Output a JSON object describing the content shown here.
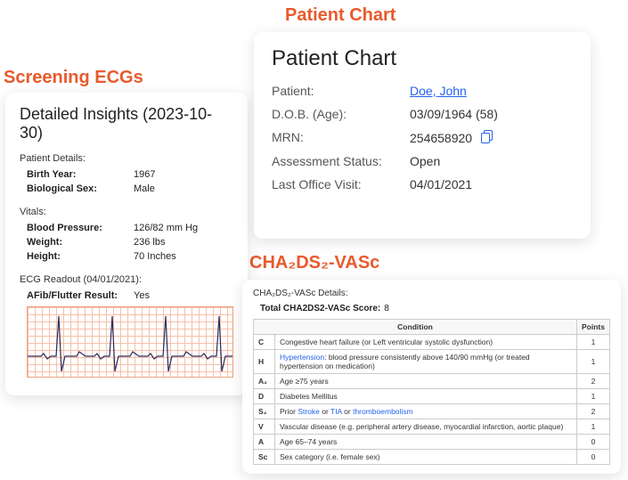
{
  "labels": {
    "patient_chart": "Patient Chart",
    "screening_ecgs": "Screening ECGs",
    "chadsvasc": "CHA₂DS₂-VASc"
  },
  "patient_chart": {
    "title": "Patient Chart",
    "rows": {
      "patient_k": "Patient:",
      "patient_v": "Doe, John",
      "dob_k": "D.O.B. (Age):",
      "dob_v": "03/09/1964 (58)",
      "mrn_k": "MRN:",
      "mrn_v": "254658920",
      "status_k": "Assessment Status:",
      "status_v": "Open",
      "visit_k": "Last Office Visit:",
      "visit_v": "04/01/2021"
    }
  },
  "ecg": {
    "title": "Detailed Insights (2023-10-30)",
    "patient_details": "Patient Details:",
    "birth_year_k": "Birth Year:",
    "birth_year_v": "1967",
    "sex_k": "Biological Sex:",
    "sex_v": "Male",
    "vitals": "Vitals:",
    "bp_k": "Blood Pressure:",
    "bp_v": "126/82 mm Hg",
    "wt_k": "Weight:",
    "wt_v": "236 lbs",
    "ht_k": "Height:",
    "ht_v": "70 Inches",
    "readout": "ECG Readout (04/01/2021):",
    "afib_k": "AFib/Flutter Result:",
    "afib_v": "Yes"
  },
  "cha": {
    "title": "CHA₂DS₂-VASc Details:",
    "score_label": "Total CHA2DS2-VASc Score:",
    "score_value": "8",
    "headers": {
      "cond": "Condition",
      "pts": "Points"
    },
    "rows": [
      {
        "code": "C",
        "cond_pre": "Congestive heart failure (or Left ventricular systolic dysfunction)",
        "link": "",
        "cond_post": "",
        "pts": "1"
      },
      {
        "code": "H",
        "cond_pre": "",
        "link": "Hypertension",
        "cond_post": ": blood pressure consistently above 140/90 mmHg (or treated hypertension on medication)",
        "pts": "1"
      },
      {
        "code": "A₂",
        "cond_pre": "Age ≥75 years",
        "link": "",
        "cond_post": "",
        "pts": "2"
      },
      {
        "code": "D",
        "cond_pre": "Diabetes Mellitus",
        "link": "",
        "cond_post": "",
        "pts": "1"
      },
      {
        "code": "S₂",
        "cond_pre": "Prior ",
        "link": "Stroke",
        "cond_post": " or TIA or thromboembolism",
        "link2": "thromboembolism",
        "pts": "2"
      },
      {
        "code": "V",
        "cond_pre": "Vascular disease (e.g. peripheral artery disease, myocardial infarction, aortic plaque)",
        "link": "",
        "cond_post": "",
        "pts": "1"
      },
      {
        "code": "A",
        "cond_pre": "Age 65–74 years",
        "link": "",
        "cond_post": "",
        "pts": "0"
      },
      {
        "code": "Sc",
        "cond_pre": "Sex category (i.e. female sex)",
        "link": "",
        "cond_post": "",
        "pts": "0"
      }
    ]
  }
}
